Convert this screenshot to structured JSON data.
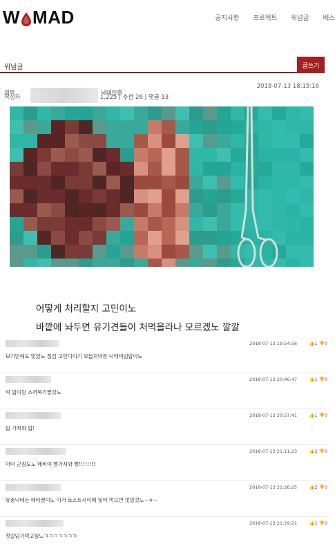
{
  "header": {
    "logo_left": "W",
    "logo_right": "MAD",
    "nav": [
      "공지사항",
      "프로젝트",
      "워넘글",
      "베스"
    ]
  },
  "board": {
    "title": "워념글",
    "write_label": "글쓰기"
  },
  "post": {
    "title_label": "제목",
    "title_visible": "낙태인증",
    "author_label": "작성자",
    "stats": "1,225  |  추천 26  |  댓글 13",
    "date": "2018-07-13 18:15:16",
    "body_lines": [
      "어떻게 처리할지 고민이노",
      "바깥에 놔두면 유기견들이 처먹을라나 모르겠노 깔깔"
    ]
  },
  "comments": [
    {
      "date": "2018-07-13 19:54:56",
      "votes": "👍1  👎0",
      "text": "보기만해도 맛있노 점심 고민다이기 오늘저녁은 낙태비빔밥이노"
    },
    {
      "date": "2018-07-13 20:46:47",
      "votes": "👍1  👎0",
      "text": "딱 밥이랑 스까묵기좋것노"
    },
    {
      "date": "2018-07-13 20:57:41",
      "votes": "👍1  👎0",
      "text": "밥 가져와 밥!"
    },
    {
      "date": "2018-07-13 21:11:23",
      "votes": "👍2  👎0",
      "text": "아따 군침도노 에비야 빵가져와 빵!!!!!!!!"
    },
    {
      "date": "2018-07-13 21:26:25",
      "votes": "👍2  👎0",
      "text": "유충낙태는 에티켓이노 이거 토스트사이에 넣어 먹으면 맛있것노~ㅎ~"
    },
    {
      "date": "2018-07-13 21:29:21",
      "votes": "👍1  👎0",
      "text": "젓갈담가먹고싶노ㅋㅋㅋㅋㅋㅋㅋ"
    }
  ],
  "colors": {
    "brand": "#a12020",
    "drop": "#b31b1b",
    "photo_bg": "#2fb7a7"
  }
}
